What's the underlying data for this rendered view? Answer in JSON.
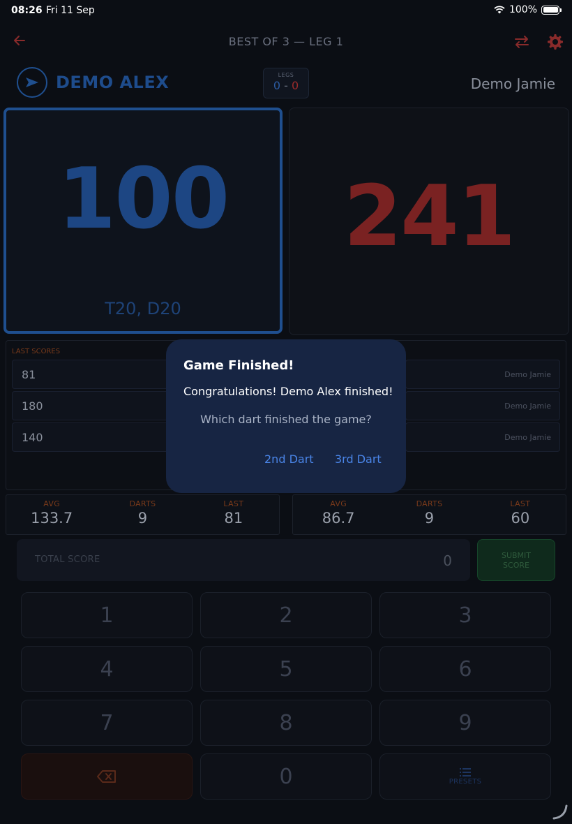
{
  "status_bar": {
    "time": "08:26",
    "date": "Fri 11 Sep",
    "battery": "100%"
  },
  "header": {
    "title": "BEST OF 3 — LEG 1",
    "back_icon": "arrow-left-icon",
    "swap_icon": "swap-icon",
    "settings_icon": "gear-icon"
  },
  "player1": {
    "name": "DEMO ALEX",
    "remaining": "100",
    "checkout": "T20, D20",
    "color": "#1f4f8f"
  },
  "player2": {
    "name": "Demo Jamie",
    "remaining": "241",
    "color": "#7a2222"
  },
  "legs": {
    "label": "LEGS",
    "p1": "0",
    "p2": "0",
    "separator": "-"
  },
  "last_scores": {
    "label": "LAST SCORES",
    "left": [
      "81",
      "180",
      "140"
    ],
    "right": [
      "Demo Jamie",
      "Demo Jamie",
      "Demo Jamie"
    ]
  },
  "stats": {
    "p1": {
      "avg_label": "AVG",
      "avg": "133.7",
      "darts_label": "DARTS",
      "darts": "9",
      "last_label": "LAST",
      "last": "81"
    },
    "p2": {
      "avg_label": "AVG",
      "avg": "86.7",
      "darts_label": "DARTS",
      "darts": "9",
      "last_label": "LAST",
      "last": "60"
    }
  },
  "total": {
    "label": "TOTAL SCORE",
    "value": "0"
  },
  "submit": {
    "line1": "SUBMIT",
    "line2": "SCORE"
  },
  "keypad": {
    "keys": [
      "1",
      "2",
      "3",
      "4",
      "5",
      "6",
      "7",
      "8",
      "9",
      "0"
    ],
    "presets_label": "PRESETS"
  },
  "dialog": {
    "title": "Game Finished!",
    "message": "Congratulations! Demo Alex finished!",
    "question": "Which dart finished the game?",
    "btn_2nd": "2nd Dart",
    "btn_3rd": "3rd Dart"
  }
}
